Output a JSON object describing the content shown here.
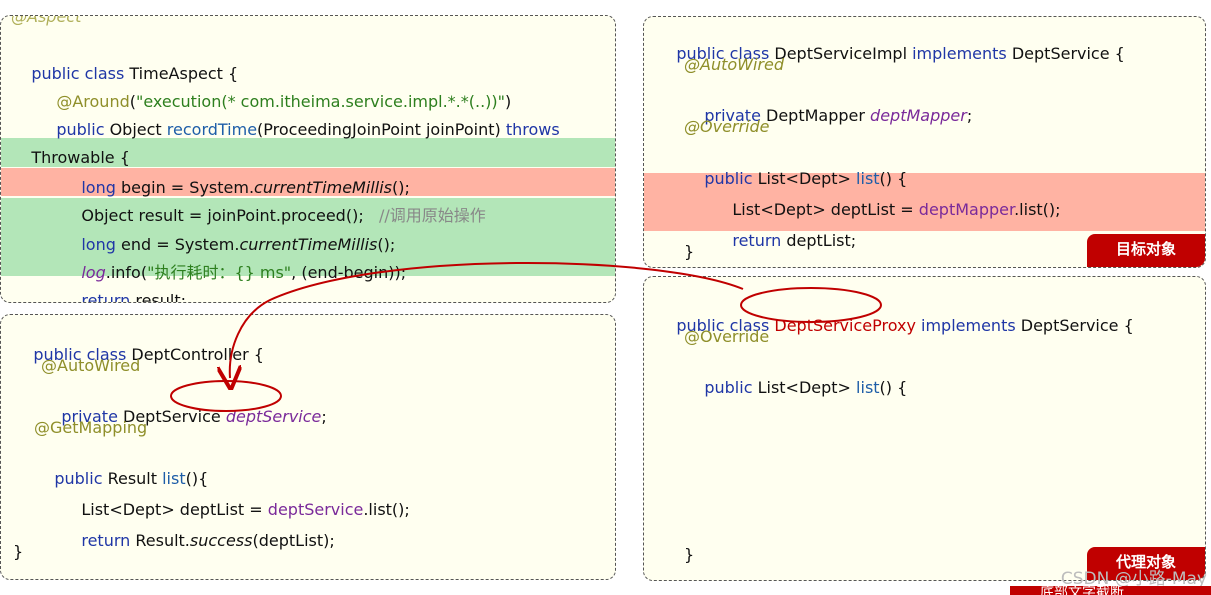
{
  "aspect": {
    "annotation": "@Aspect",
    "lines": [
      [
        "public class ",
        "TimeAspect {"
      ],
      [
        "@Around",
        "(",
        "\"execution(* com.itheima.service.impl.*.*(..))\"",
        ")"
      ],
      [
        "public ",
        "Object ",
        "recordTime",
        "(ProceedingJoinPoint joinPoint) ",
        "throws"
      ],
      [
        "Throwable {"
      ],
      [
        "long ",
        "begin = System.",
        "currentTimeMillis",
        "();"
      ],
      [
        "Object result = joinPoint.proceed();",
        "   //调用原始操作"
      ],
      [
        "long ",
        "end = System.",
        "currentTimeMillis",
        "();"
      ],
      [
        "log",
        ".info(",
        "\"执行耗时：{} ms\"",
        ", (end-begin));"
      ],
      [
        "return ",
        "result;"
      ]
    ]
  },
  "controller": {
    "lines": [
      [
        "public class ",
        "DeptController {"
      ],
      [
        "@AutoWired"
      ],
      [
        "private ",
        "DeptService ",
        "deptService",
        ";"
      ],
      [
        "@GetMapping"
      ],
      [
        "public ",
        "Result ",
        "list",
        "(){"
      ],
      [
        "List<Dept> deptList = ",
        "deptService",
        ".list();"
      ],
      [
        "return ",
        "Result.",
        "success",
        "(deptList);"
      ],
      [
        "}"
      ]
    ]
  },
  "impl": {
    "lines": [
      [
        "public class ",
        "DeptServiceImpl ",
        "implements ",
        "DeptService {"
      ],
      [
        "@AutoWired"
      ],
      [
        "private ",
        "DeptMapper ",
        "deptMapper",
        ";"
      ],
      [
        "@Override"
      ],
      [
        "public ",
        "List<Dept> ",
        "list",
        "() {"
      ],
      [
        "List<Dept> deptList = ",
        "deptMapper",
        ".list();"
      ],
      [
        "return ",
        "deptList;"
      ],
      [
        "}"
      ]
    ],
    "tag": "目标对象"
  },
  "proxy": {
    "lines": [
      [
        "public class ",
        "DeptServiceProxy",
        " implements ",
        "DeptService {"
      ],
      [
        "@Override"
      ],
      [
        "public ",
        "List<Dept> ",
        "list",
        "() {"
      ],
      [
        "}"
      ]
    ],
    "tag": "代理对象"
  },
  "watermark": "CSDN @小路-May",
  "cutoff_text": "底部文字截断",
  "colors": {
    "highlight_green": "#b3e6b8",
    "highlight_red": "#ffb3a3",
    "tag_red": "#c00000",
    "arrow_red": "#c00000"
  }
}
